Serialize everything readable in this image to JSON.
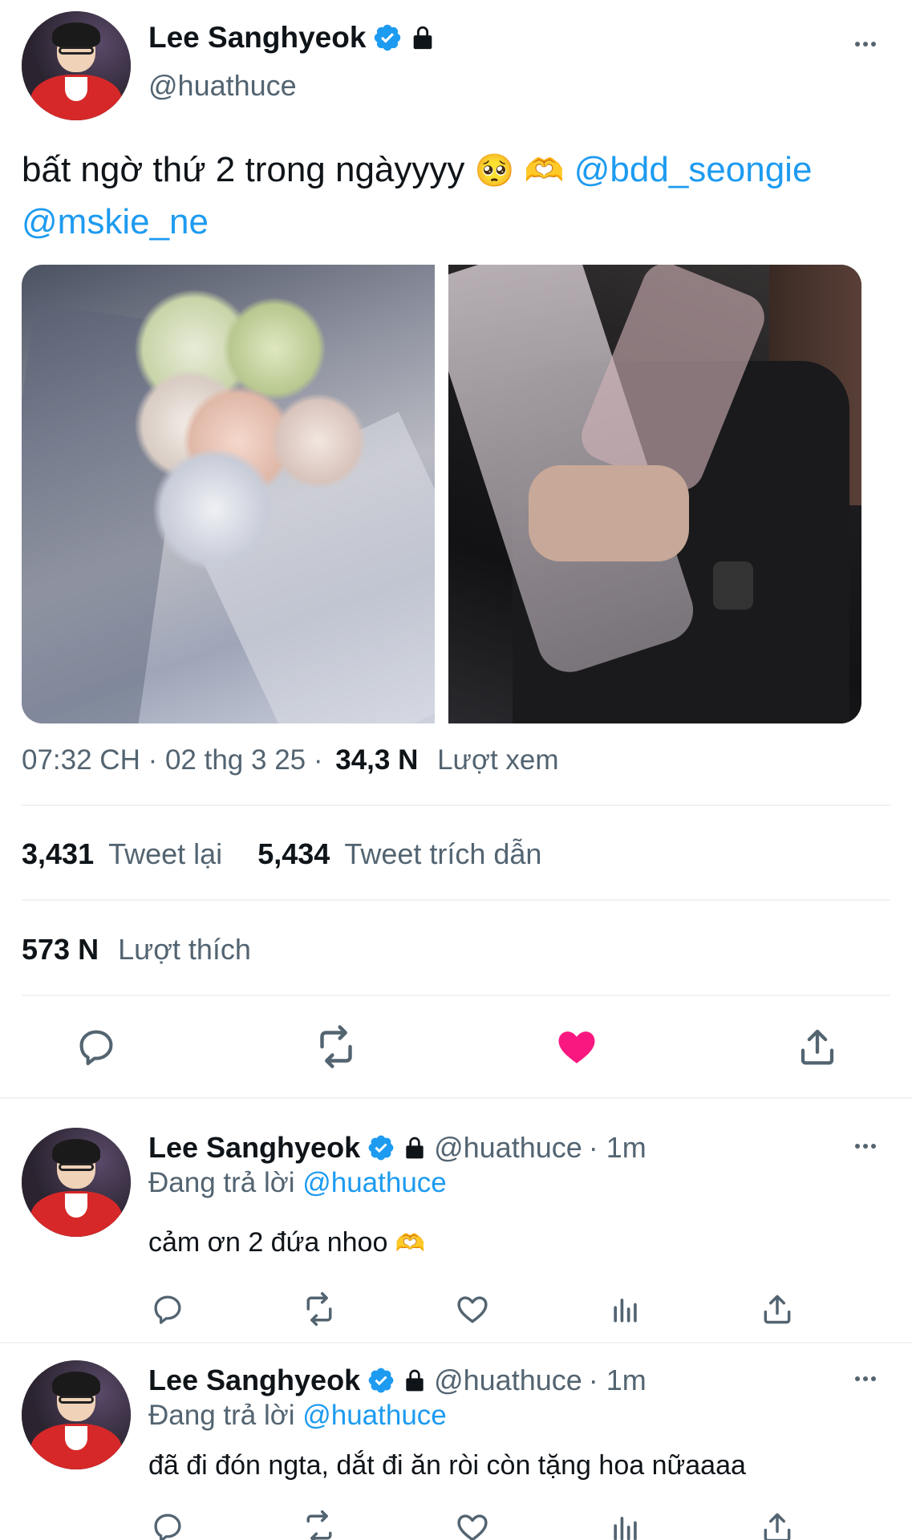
{
  "main_tweet": {
    "author_name": "Lee Sanghyeok",
    "handle": "@huathuce",
    "text": "bất ngờ thứ 2 trong ngàyyyy",
    "emojis": [
      "🥺",
      "🫶"
    ],
    "mentions": [
      "@bdd_seongie",
      "@mskie_ne"
    ],
    "timestamp": "07:32 CH · 02 thg 3 25 ·",
    "views_count": "34,3 N",
    "views_label": "Lượt xem",
    "retweets_count": "3,431",
    "retweets_label": "Tweet lại",
    "quotes_count": "5,434",
    "quotes_label": "Tweet trích dẫn",
    "likes_count": "573 N",
    "likes_label": "Lượt thích",
    "liked": true
  },
  "replies": [
    {
      "author_name": "Lee Sanghyeok",
      "handle": "@huathuce",
      "time": "· 1m",
      "replying_prefix": "Đang trả lời",
      "replying_to": "@huathuce",
      "text": "cảm ơn 2 đứa nhoo",
      "emoji": "🫶"
    },
    {
      "author_name": "Lee Sanghyeok",
      "handle": "@huathuce",
      "time": "· 1m",
      "replying_prefix": "Đang trả lời",
      "replying_to": "@huathuce",
      "text": "đã đi đón ngta, dắt đi ăn ròi còn tặng hoa nữaaaa",
      "emoji": ""
    }
  ],
  "icons": {
    "verified": "verified-badge-icon",
    "lock": "lock-icon",
    "more": "more-dots-icon",
    "reply": "reply-icon",
    "retweet": "retweet-icon",
    "like": "heart-icon",
    "views": "analytics-icon",
    "share": "share-icon"
  },
  "colors": {
    "accent": "#1d9bf0",
    "like": "#f91880",
    "text": "#0f1419",
    "muted": "#536471"
  }
}
